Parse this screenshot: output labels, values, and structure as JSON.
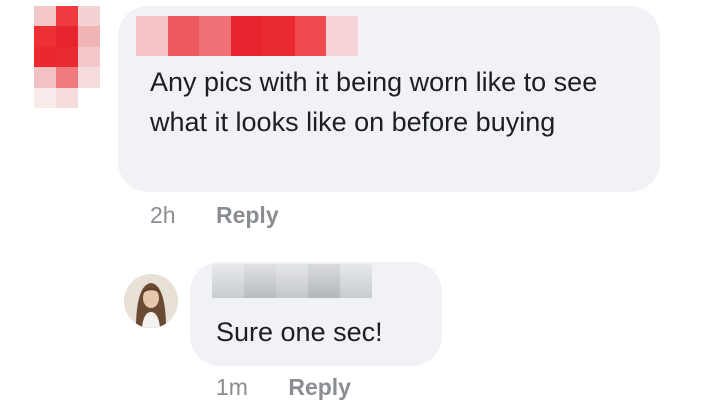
{
  "comment": {
    "text": "Any pics with it being worn like to see what it looks like on before buying",
    "time": "2h",
    "reply_label": "Reply"
  },
  "reply": {
    "text": "Sure one sec!",
    "time": "1m",
    "reply_label": "Reply"
  },
  "colors": {
    "bubble": "#f0f2f5",
    "meta_text": "#8a8d91",
    "redaction_red": "#e8242e"
  }
}
